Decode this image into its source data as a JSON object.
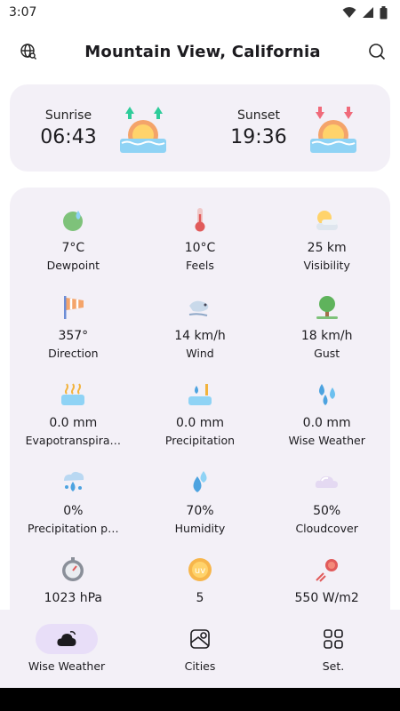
{
  "status": {
    "time": "3:07"
  },
  "header": {
    "title": "Mountain View, California",
    "left_icon": "globe-search-icon",
    "right_icon": "search-icon"
  },
  "sun": {
    "sunrise_label": "Sunrise",
    "sunrise_time": "06:43",
    "sunset_label": "Sunset",
    "sunset_time": "19:36"
  },
  "metrics": [
    {
      "value": "7°C",
      "label": "Dewpoint",
      "icon": "dewpoint-icon"
    },
    {
      "value": "10°C",
      "label": "Feels",
      "icon": "thermometer-icon"
    },
    {
      "value": "25 km",
      "label": "Visibility",
      "icon": "visibility-icon"
    },
    {
      "value": "357°",
      "label": "Direction",
      "icon": "wind-direction-icon"
    },
    {
      "value": "14 km/h",
      "label": "Wind",
      "icon": "wind-icon"
    },
    {
      "value": "18 km/h",
      "label": "Gust",
      "icon": "gust-icon"
    },
    {
      "value": "0.0 mm",
      "label": "Evapotranspira…",
      "icon": "evapotranspiration-icon"
    },
    {
      "value": "0.0 mm",
      "label": "Precipitation",
      "icon": "precipitation-icon"
    },
    {
      "value": "0.0 mm",
      "label": "Wise Weather",
      "icon": "raindrops-icon"
    },
    {
      "value": "0%",
      "label": "Precipitation p…",
      "icon": "precipitation-probability-icon"
    },
    {
      "value": "70%",
      "label": "Humidity",
      "icon": "humidity-icon"
    },
    {
      "value": "50%",
      "label": "Cloudcover",
      "icon": "cloudcover-icon"
    },
    {
      "value": "1023 hPa",
      "label": "",
      "icon": "pressure-icon"
    },
    {
      "value": "5",
      "label": "",
      "icon": "uv-index-icon"
    },
    {
      "value": "550 W/m2",
      "label": "",
      "icon": "radiation-icon"
    }
  ],
  "nav": [
    {
      "label": "Wise Weather",
      "icon": "weather-icon"
    },
    {
      "label": "Cities",
      "icon": "map-icon"
    },
    {
      "label": "Set.",
      "icon": "grid-icon"
    }
  ],
  "colors": {
    "card_bg": "#f3f0f7",
    "nav_active": "#e8def8"
  }
}
